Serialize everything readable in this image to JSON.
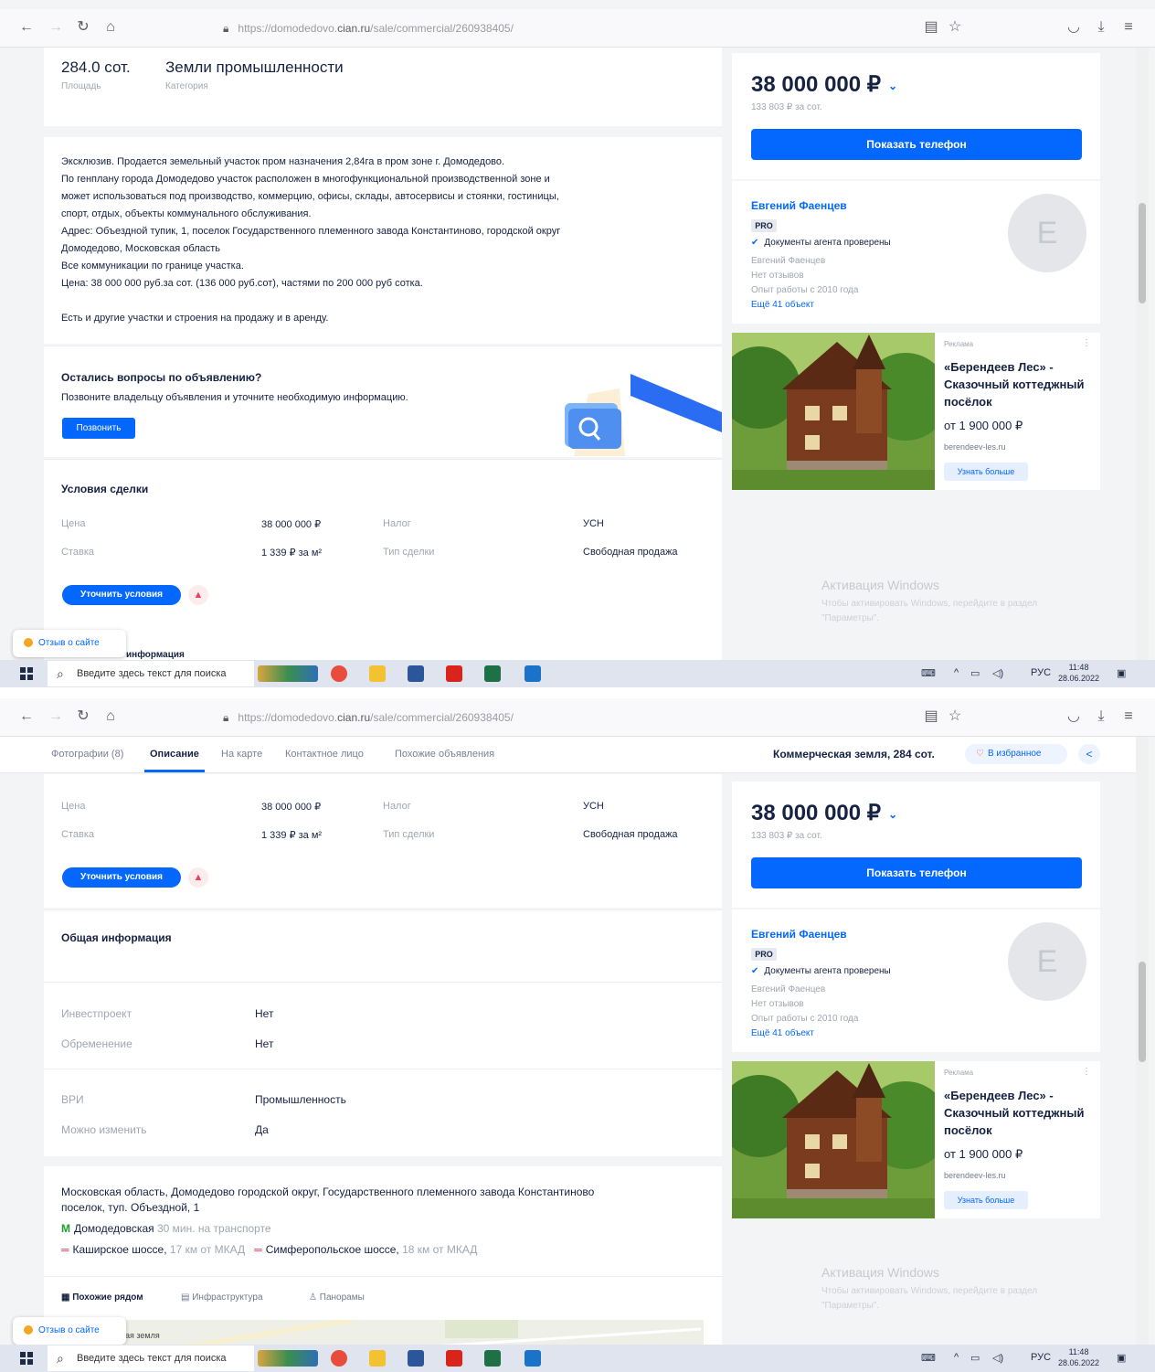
{
  "browser": {
    "url_prefix": "https://domodedovo.",
    "url_host": "cian.ru",
    "url_path": "/sale/commercial/260938405/"
  },
  "listing": {
    "area_value": "284.0 сот.",
    "area_label": "Площадь",
    "category_value": "Земли промышленности",
    "category_label": "Категория",
    "description": [
      "Эксклюзив. Продается земельный участок пром назначения 2,84га в пром зоне г. Домодедово.",
      "По генплану города Домодедово участок расположен в многофункциональной производственной зоне и",
      "может использоваться под производство, коммерцию, офисы, склады, автосервисы и стоянки, гостиницы,",
      "спорт, отдых, объекты коммунального обслуживания.",
      "Адрес: Объездной тупик, 1, поселок Государственного племенного завода Константиново, городской округ",
      "Домодедово, Московская область",
      "Все коммуникации по границе участка.",
      "Цена: 38 000 000 руб.за сот. (136 000 руб.сот), частями по 200 000 руб сотка.",
      "",
      "Есть и другие участки и строения на продажу и в аренду."
    ],
    "questions_title": "Остались вопросы по объявлению?",
    "questions_text": "Позвоните владельцу объявления и уточните необходимую информацию.",
    "call_button": "Позвонить",
    "deal_title": "Условия сделки",
    "deal": {
      "price_label": "Цена",
      "price_value": "38 000 000 ₽",
      "tax_label": "Налог",
      "tax_value": "УСН",
      "rate_label": "Ставка",
      "rate_value": "1 339 ₽ за м²",
      "deal_type_label": "Тип сделки",
      "deal_type_value": "Свободная продажа"
    },
    "clarify_button": "Уточнить условия",
    "warn_icon_text": "▲",
    "cut_heading": "информация",
    "general_title": "Общая информация",
    "general": [
      {
        "label": "Инвестпроект",
        "value": "Нет"
      },
      {
        "label": "Обременение",
        "value": "Нет"
      },
      {
        "label": "ВРИ",
        "value": "Промышленность"
      },
      {
        "label": "Можно изменить",
        "value": "Да"
      }
    ],
    "address_line1": "Московская область, Домодедово городской округ, Государственного племенного завода Константиново",
    "address_line2": "поселок, туп. Объездной, 1",
    "metro_icon": "M",
    "metro_name": "Домодедовская",
    "metro_time": "30 мин. на транспорте",
    "highway1": "Каширское шоссе,",
    "highway1_dist": "17 км от МКАД",
    "highway2": "Симферопольское шоссе,",
    "highway2_dist": "18 км от МКАД",
    "highway_icon": "═",
    "map_tabs": [
      "Похожие рядом",
      "Инфраструктура",
      "Панорамы"
    ],
    "map_tab_icons": [
      "▦",
      "▤",
      "♙"
    ],
    "map_text": "ая земля"
  },
  "sticky": {
    "tabs": [
      "Фотографии (8)",
      "Описание",
      "На карте",
      "Контактное лицо",
      "Похожие объявления"
    ],
    "title": "Коммерческая земля, 284 сот.",
    "fav_label": "В избранное",
    "share_icon": "<"
  },
  "sidebar": {
    "price": "38 000 000 ₽",
    "price_chevron": "⌄",
    "price_per": "133 803 ₽ за сот.",
    "phone_button": "Показать телефон",
    "agent_name": "Евгений Фаенцев",
    "agent_badge": "PRO",
    "agent_verified": "Документы агента проверены",
    "agent_sub": "Евгений Фаенцев",
    "agent_reviews": "Нет отзывов",
    "agent_experience": "Опыт работы с 2010 года",
    "agent_more": "Ещё 41 объект",
    "avatar_letter": "Е"
  },
  "ad": {
    "tag": "Реклама",
    "title": "«Берендеев Лес» - Сказочный коттеджный посёлок",
    "price": "от 1 900 000 ₽",
    "site": "berendeev-les.ru",
    "more": "Узнать больше"
  },
  "windows": {
    "watermark_title": "Активация Windows",
    "watermark_text1": "Чтобы активировать Windows, перейдите в раздел",
    "watermark_text2": "\"Параметры\".",
    "search_placeholder": "Введите здесь текст для поиска",
    "lang": "РУС",
    "time": "11:48",
    "date": "28.06.2022"
  },
  "feedback": "Отзыв о сайте",
  "colors": {
    "accent": "#0468ff",
    "text": "#152242",
    "muted": "#a0a6b2",
    "danger": "#e84260"
  }
}
